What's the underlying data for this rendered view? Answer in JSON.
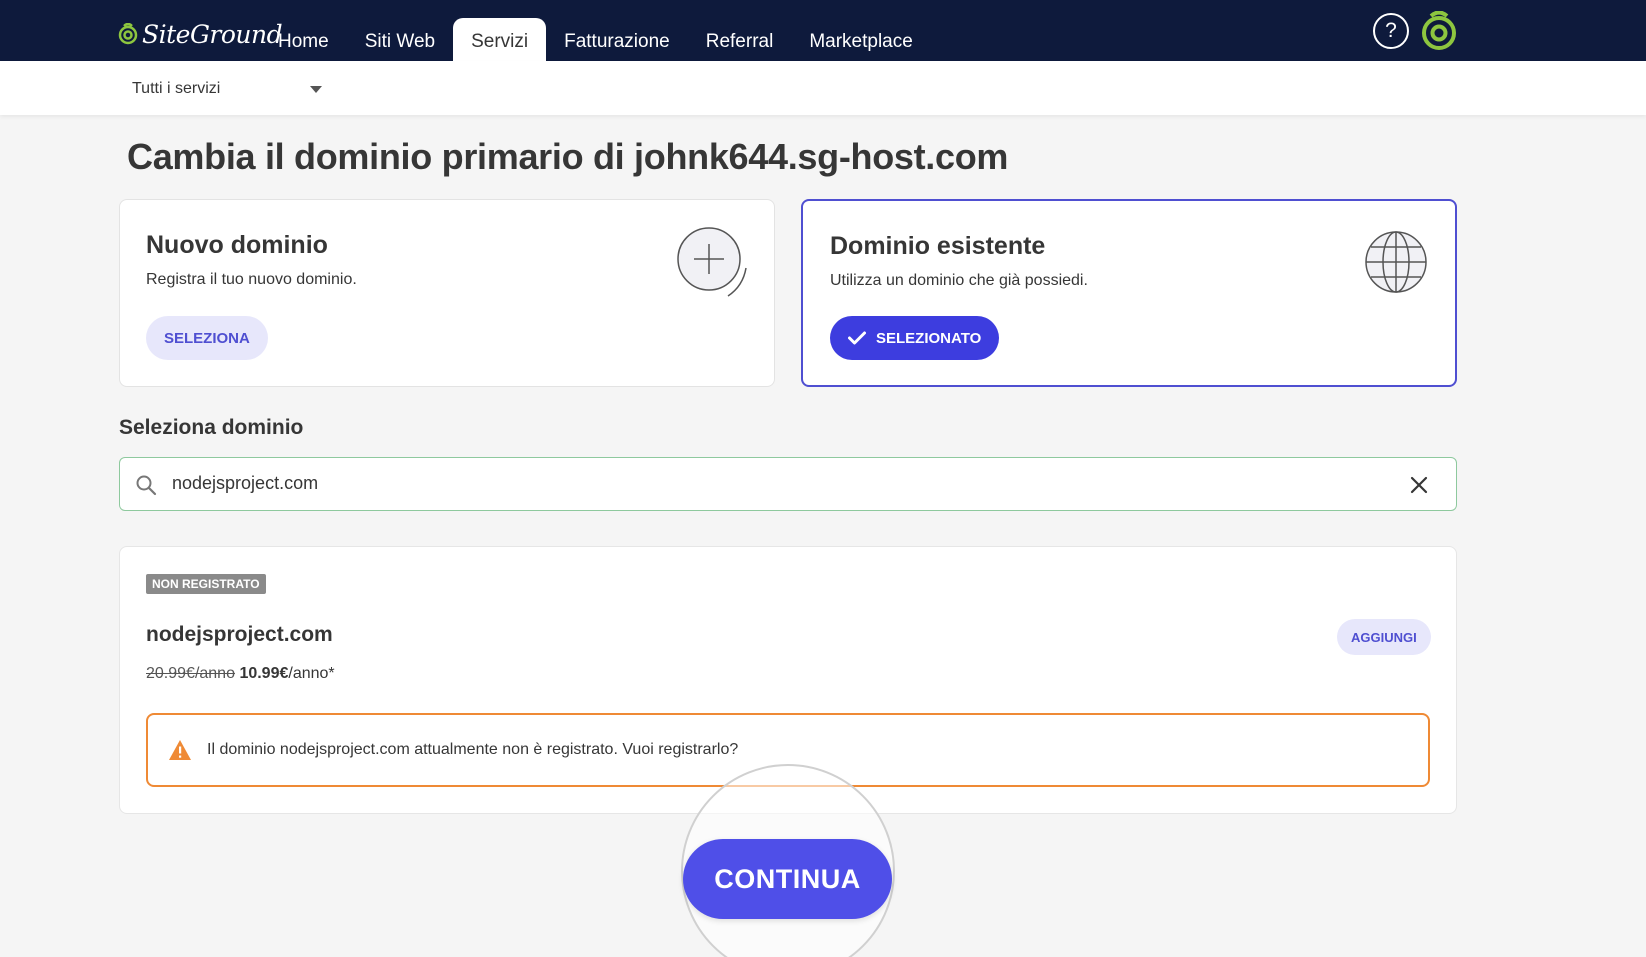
{
  "brand": {
    "name": "SiteGround",
    "accent": "#4f4fd1",
    "topbar_bg": "#0e1a3c"
  },
  "nav": {
    "items": [
      {
        "label": "Home"
      },
      {
        "label": "Siti Web"
      },
      {
        "label": "Servizi",
        "active": true
      },
      {
        "label": "Fatturazione"
      },
      {
        "label": "Referral"
      },
      {
        "label": "Marketplace"
      }
    ],
    "help_icon": "question-circle-icon",
    "help_glyph": "?",
    "profile_icon": "siteground-avatar-icon"
  },
  "subbar": {
    "services_select": "Tutti i servizi"
  },
  "page": {
    "title": "Cambia il dominio primario di johnk644.sg-host.com"
  },
  "options": {
    "new": {
      "title": "Nuovo dominio",
      "description": "Registra il tuo nuovo dominio.",
      "button": "SELEZIONA",
      "icon": "plus-circle-icon"
    },
    "existing": {
      "title": "Dominio esistente",
      "description": "Utilizza un dominio che già possiedi.",
      "button": "SELEZIONATO",
      "selected": true,
      "icon": "globe-icon"
    }
  },
  "domain_select": {
    "label": "Seleziona dominio",
    "value": "nodejsproject.com"
  },
  "result": {
    "badge": "NON REGISTRATO",
    "domain": "nodejsproject.com",
    "old_price": "20.99€/anno",
    "new_price": "10.99€",
    "price_suffix": "/anno*",
    "add_button": "AGGIUNGI",
    "alert": "Il dominio nodejsproject.com attualmente non è registrato. Vuoi registrarlo?",
    "alert_color": "#ef8a35"
  },
  "continue_button": "CONTINUA"
}
